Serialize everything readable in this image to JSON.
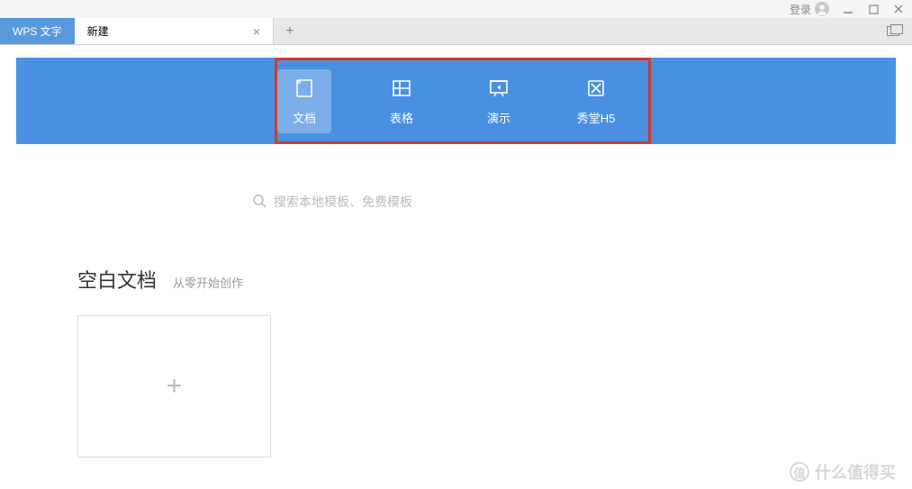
{
  "titlebar": {
    "login": "登录"
  },
  "tabs": {
    "app": "WPS 文字",
    "active": "新建"
  },
  "docTypes": [
    {
      "label": "文档",
      "icon": "document"
    },
    {
      "label": "表格",
      "icon": "spreadsheet"
    },
    {
      "label": "演示",
      "icon": "presentation"
    },
    {
      "label": "秀堂H5",
      "icon": "h5"
    }
  ],
  "search": {
    "placeholder": "搜索本地模板、免费模板"
  },
  "section": {
    "title": "空白文档",
    "subtitle": "从零开始创作"
  },
  "watermark": {
    "badge": "值",
    "text": "什么值得买"
  }
}
